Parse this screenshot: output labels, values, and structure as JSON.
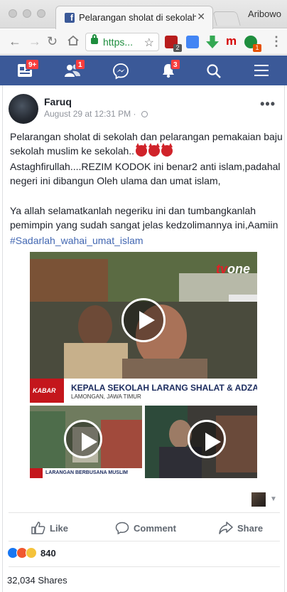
{
  "browser": {
    "tab_title": "Pelarangan sholat di sekolah",
    "url": "https...",
    "profile_name": "Aribowo",
    "extensions": [
      {
        "icon": "shield-ext-icon",
        "badge": "2",
        "color": "#b71c1c",
        "badge_color": "#555555"
      },
      {
        "icon": "translate-icon",
        "badge": "",
        "color": "#4285f4"
      },
      {
        "icon": "download-ext-icon",
        "badge": "",
        "color": "#34a853"
      },
      {
        "icon": "mendeley-icon",
        "badge": "",
        "color": "#d50000"
      },
      {
        "icon": "grammarly-icon",
        "badge": "1",
        "color": "#1e8e3e",
        "badge_color": "#e65100"
      }
    ]
  },
  "fb_nav": {
    "feed_badge": "9+",
    "friends_badge": "1",
    "notifications_badge": "3"
  },
  "post": {
    "author": "Faruq",
    "timestamp": "August 29 at 12:31 PM",
    "paragraph1": "Pelarangan sholat di sekolah dan pelarangan pemakaian baju sekolah muslim ke sekolah..",
    "paragraph2": "Astaghfirullah....REZIM KODOK ini benar2 anti islam,padahal negeri ini dibangun Oleh ulama dan umat islam,",
    "paragraph3": "Ya allah selamatkanlah negeriku ini dan tumbangkanlah pemimpin yang sudah sangat jelas kedzolimannya ini,Aamiin",
    "hashtag": "#Sadarlah_wahai_umat_islam",
    "main_video": {
      "channel_logo_a": "tv",
      "channel_logo_b": "one",
      "program_tag": "KABAR",
      "headline": "KEPALA SEKOLAH LARANG SHALAT & ADZAN",
      "location": "LAMONGAN, JAWA TIMUR"
    },
    "video2_caption": "LARANGAN BERBUSANA MUSLIM"
  },
  "actions": {
    "like": "Like",
    "comment": "Comment",
    "share": "Share"
  },
  "stats": {
    "reaction_count": "840",
    "shares": "32,034 Shares"
  },
  "colors": {
    "fb_blue": "#3b5998",
    "link_blue": "#4267b2",
    "badge_red": "#fa3e3e"
  }
}
